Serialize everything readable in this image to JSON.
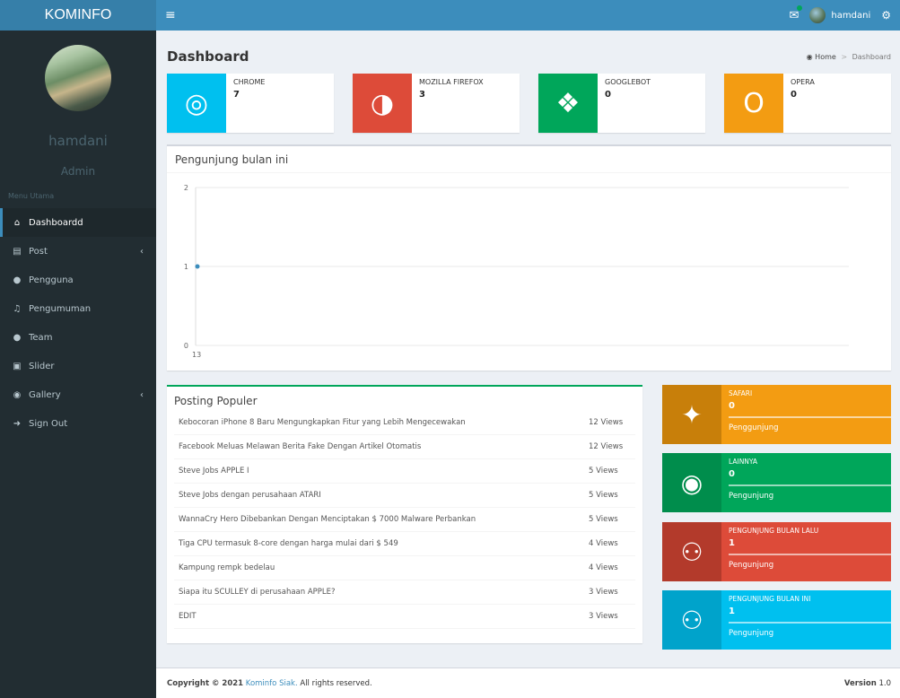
{
  "header": {
    "brand": "KOMINFO",
    "menu_icon": "hamburger-icon",
    "user_name": "hamdani"
  },
  "sidebar": {
    "user_name": "hamdani",
    "user_role": "Admin",
    "section": "Menu Utama",
    "items": [
      {
        "label": "Dashboardd",
        "icon": "home-icon"
      },
      {
        "label": "Post",
        "icon": "newspaper-icon"
      },
      {
        "label": "Pengguna",
        "icon": "users-icon"
      },
      {
        "label": "Pengumuman",
        "icon": "volume-icon"
      },
      {
        "label": "Team",
        "icon": "users-icon"
      },
      {
        "label": "Slider",
        "icon": "clone-icon"
      },
      {
        "label": "Gallery",
        "icon": "camera-icon"
      },
      {
        "label": "Sign Out",
        "icon": "sign-out-icon"
      }
    ]
  },
  "page": {
    "title": "Dashboard"
  },
  "breadcrumb": {
    "home": "Home",
    "current": "Dashboard"
  },
  "browser_stats": [
    {
      "label": "CHROME",
      "value": "7",
      "color": "#00c0ef",
      "icon": "chrome-icon"
    },
    {
      "label": "MOZILLA FIREFOX",
      "value": "3",
      "color": "#dd4b39",
      "icon": "firefox-icon"
    },
    {
      "label": "GOOGLEBOT",
      "value": "0",
      "color": "#00a65a",
      "icon": "bug-icon"
    },
    {
      "label": "OPERA",
      "value": "0",
      "color": "#f39c12",
      "icon": "opera-icon"
    }
  ],
  "visitors_chart": {
    "title": "Pengunjung bulan ini"
  },
  "chart_data": {
    "type": "line",
    "x": [
      "13"
    ],
    "values": [
      1
    ],
    "ylim": [
      0,
      2
    ],
    "yticks": [
      0,
      1,
      2
    ],
    "grid": true,
    "color": "#3c8dbc"
  },
  "popular": {
    "title": "Posting Populer",
    "rows": [
      {
        "title": "Kebocoran iPhone 8 Baru Mengungkapkan Fitur yang Lebih Mengecewakan",
        "views": "12 Views"
      },
      {
        "title": "Facebook Meluas Melawan Berita Fake Dengan Artikel Otomatis",
        "views": "12 Views"
      },
      {
        "title": "Steve Jobs APPLE I",
        "views": "5 Views"
      },
      {
        "title": "Steve Jobs dengan perusahaan ATARI",
        "views": "5 Views"
      },
      {
        "title": "WannaCry Hero Dibebankan Dengan Menciptakan $ 7000 Malware Perbankan",
        "views": "5 Views"
      },
      {
        "title": "Tiga CPU termasuk 8-core dengan harga mulai dari $ 549",
        "views": "4 Views"
      },
      {
        "title": "Kampung rempk bedelau",
        "views": "4 Views"
      },
      {
        "title": "Siapa itu SCULLEY di perusahaan APPLE?",
        "views": "3 Views"
      },
      {
        "title": "EDIT",
        "views": "3 Views"
      }
    ]
  },
  "stat_boxes": [
    {
      "label": "SAFARI",
      "value": "0",
      "desc": "Penggunjung",
      "color": "#f39c12",
      "dark": "#c87f0a",
      "icon": "compass-icon"
    },
    {
      "label": "LAINNYA",
      "value": "0",
      "desc": "Pengunjung",
      "color": "#00a65a",
      "dark": "#008d4c",
      "icon": "globe-icon"
    },
    {
      "label": "PENGUNJUNG BULAN LALU",
      "value": "1",
      "desc": "Pengunjung",
      "color": "#dd4b39",
      "dark": "#b33a2b",
      "icon": "users-icon"
    },
    {
      "label": "PENGUNJUNG BULAN INI",
      "value": "1",
      "desc": "Pengunjung",
      "color": "#00c0ef",
      "dark": "#00a3cb",
      "icon": "users-icon"
    }
  ],
  "footer": {
    "copyright_prefix": "Copyright © 2021",
    "org": "Kominfo Siak.",
    "suffix": "All rights reserved.",
    "version_label": "Version",
    "version": "1.0"
  }
}
